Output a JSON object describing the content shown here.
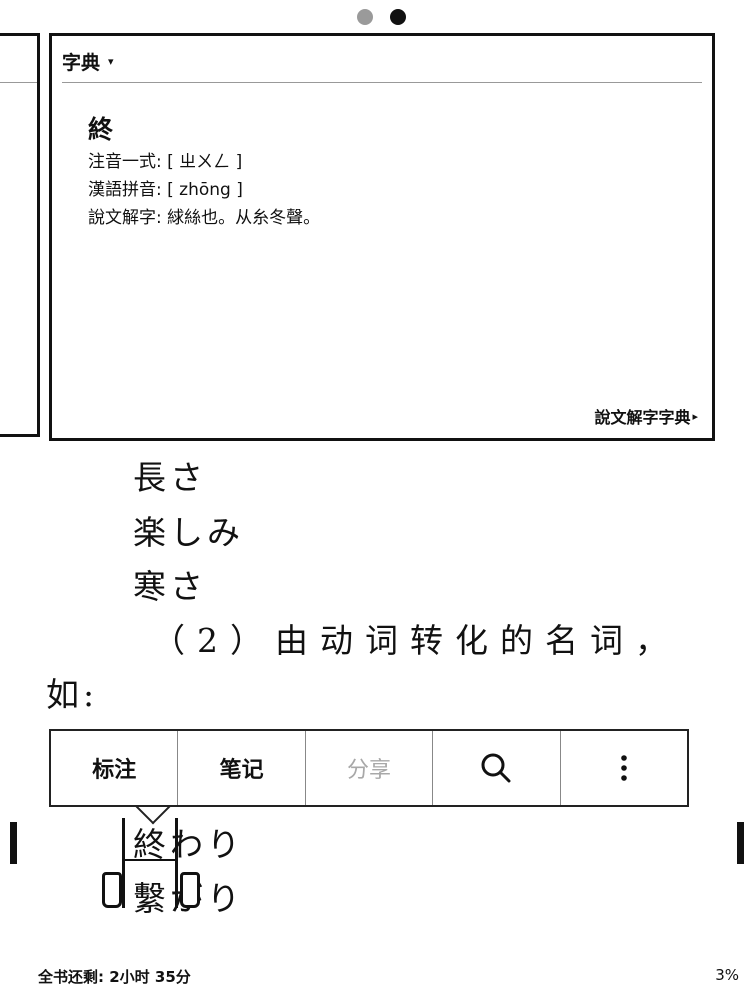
{
  "page_indicator": {
    "count": 2,
    "active": 2
  },
  "dictionary": {
    "header_label": "字典",
    "caret": "▾",
    "headword": "終",
    "lines": [
      "注音一式: [ ㄓㄨㄥ ]",
      "漢語拼音: [ zhōng ]",
      "說文解字:  絿絲也。从糸冬聲。"
    ],
    "source_link": "說文解字字典",
    "source_arrow": "▸"
  },
  "page_text": {
    "line1": "長さ",
    "line2": "楽しみ",
    "line3": "寒さ",
    "line4": "（2）由动词转化的名词，",
    "line5": "如:",
    "line6": "終わり",
    "line7": "繫がり"
  },
  "toolbar": {
    "highlight_label": "标注",
    "note_label": "笔记",
    "share_label": "分享",
    "search_icon": "search-icon",
    "more_icon": "more-vertical-icon"
  },
  "footer": {
    "time_left": "全书还剩: 2小时 35分",
    "percent": "3%"
  }
}
